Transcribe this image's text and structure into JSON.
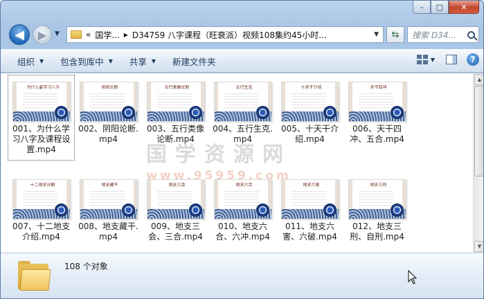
{
  "window": {
    "caption_buttons": [
      "–",
      "□",
      "✕"
    ]
  },
  "navigation": {
    "back_glyph": "◀",
    "forward_glyph": "▶",
    "address_segments": [
      "«",
      "国学...",
      "▸",
      "D34759 八字课程（旺衰派）视频108集约45小时..."
    ],
    "search_placeholder": "搜索 D34..."
  },
  "toolbar": {
    "organize": "组织",
    "include_in_library": "包含到库中",
    "share": "共享",
    "new_folder": "新建文件夹"
  },
  "files": [
    {
      "name": "001、为什么学习八字及课程设置.mp4",
      "thumb_title": "为什么要学习八字",
      "selected": true
    },
    {
      "name": "002、阴阳论断.mp4",
      "thumb_title": "阴阳论断",
      "selected": false
    },
    {
      "name": "003、五行类像论断.mp4",
      "thumb_title": "五行类像论断",
      "selected": false
    },
    {
      "name": "004、五行生克.mp4",
      "thumb_title": "五行生克",
      "selected": false
    },
    {
      "name": "005、十天干介绍.mp4",
      "thumb_title": "十天干介绍",
      "selected": false
    },
    {
      "name": "006、天干四冲、五合.mp4",
      "thumb_title": "天干四冲",
      "selected": false
    },
    {
      "name": "007、十二地支介绍.mp4",
      "thumb_title": "十二地支详解",
      "selected": false
    },
    {
      "name": "008、地支藏干.mp4",
      "thumb_title": "地支藏干",
      "selected": false
    },
    {
      "name": "009、地支三会、三合.mp4",
      "thumb_title": "地支三会",
      "selected": false
    },
    {
      "name": "010、地支六合、六冲.mp4",
      "thumb_title": "地支六合",
      "selected": false
    },
    {
      "name": "011、地支六害、六破.mp4",
      "thumb_title": "地支六害",
      "selected": false
    },
    {
      "name": "012、地支三刑、自刑.mp4",
      "thumb_title": "地支三刑",
      "selected": false
    }
  ],
  "watermark": {
    "text": "国学资源网",
    "url": "www.95959.com"
  },
  "status": {
    "count_text": "108 个对象"
  }
}
